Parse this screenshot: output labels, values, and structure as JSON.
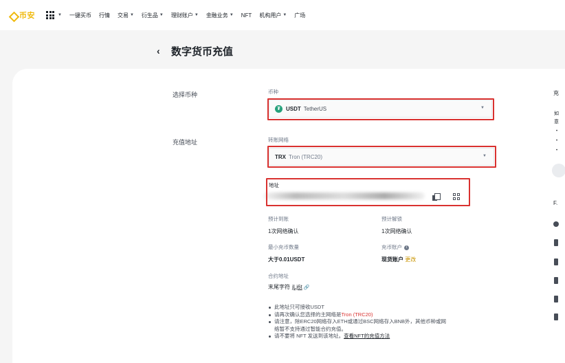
{
  "nav": {
    "brand": "币安",
    "items": [
      {
        "label": "一键买币",
        "dropdown": false
      },
      {
        "label": "行情",
        "dropdown": false
      },
      {
        "label": "交易",
        "dropdown": true
      },
      {
        "label": "衍生品",
        "dropdown": true
      },
      {
        "label": "理财账户",
        "dropdown": true
      },
      {
        "label": "金融业务",
        "dropdown": true
      },
      {
        "label": "NFT",
        "dropdown": false
      },
      {
        "label": "机构用户",
        "dropdown": true
      },
      {
        "label": "广场",
        "dropdown": false
      }
    ]
  },
  "page": {
    "title": "数字货币充值"
  },
  "form": {
    "select_coin_label": "选择币种",
    "deposit_address_label": "充值地址",
    "coin": {
      "field_label": "币种",
      "symbol": "USDT",
      "name": "TetherUS"
    },
    "network": {
      "field_label": "转账网络",
      "symbol": "TRX",
      "name": "Tron (TRC20)"
    },
    "address": {
      "field_label": "地址"
    }
  },
  "info": {
    "expected_arrival_label": "预计到账",
    "expected_arrival_value": "1次网络确认",
    "expected_unlock_label": "预计解锁",
    "expected_unlock_value": "1次网络确认",
    "min_deposit_label": "最小充币数量",
    "min_deposit_value": "大于0.01USDT",
    "deposit_account_label": "充币账户",
    "deposit_account_value": "现货账户",
    "change_link": "更改",
    "contract_label": "合约地址",
    "contract_prefix": "末尾字符",
    "contract_suffix": "jLj6t"
  },
  "notes": {
    "n1": "此地址只可接收USDT",
    "n2_prefix": "请再次确认您选择的主网络是",
    "n2_network": "Tron (TRC20)",
    "n3_line1": "请注意，除ERC20网络存入ETH或通过BSC网络存入BNB外，其他币种或网",
    "n3_line2": "络暂不支持通过智能合约充值。",
    "n4_prefix": "请不要将 NFT 发送到该地址。",
    "n4_link": "查看NFT的充值方法"
  },
  "right_panel": {
    "frag1": "充",
    "frag2": "如",
    "frag3": "意",
    "frag4": "F."
  },
  "colors": {
    "brand": "#f0b90b",
    "highlight": "#d9312f",
    "usdt": "#26a17b",
    "link": "#c99400"
  }
}
